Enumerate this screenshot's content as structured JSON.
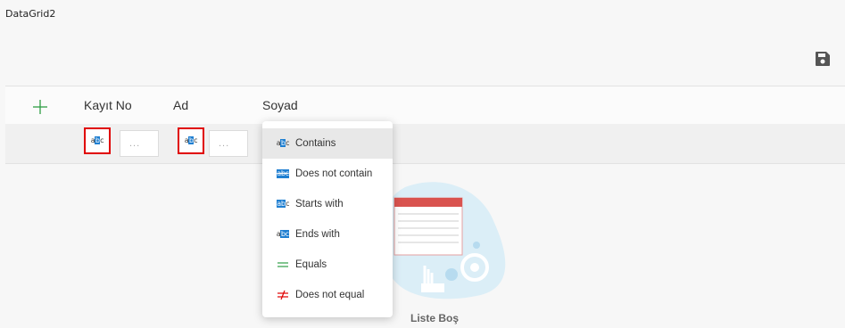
{
  "app": {
    "title": "DataGrid2"
  },
  "toolbar": {
    "save_icon": "floppy-disk-icon"
  },
  "grid": {
    "columns": [
      {
        "label": "Kayıt No"
      },
      {
        "label": "Ad"
      },
      {
        "label": "Soyad"
      }
    ],
    "filter_placeholder": "...",
    "empty_text": "Liste Boş"
  },
  "filter_menu": {
    "items": [
      {
        "label": "Contains",
        "icon": "contains-icon",
        "selected": true
      },
      {
        "label": "Does not contain",
        "icon": "does-not-contain-icon"
      },
      {
        "label": "Starts with",
        "icon": "starts-with-icon"
      },
      {
        "label": "Ends with",
        "icon": "ends-with-icon"
      },
      {
        "label": "Equals",
        "icon": "equals-icon"
      },
      {
        "label": "Does not equal",
        "icon": "not-equal-icon"
      }
    ]
  },
  "colors": {
    "accent_blue": "#1f7fd1",
    "add_green": "#2e9e45",
    "highlight_red": "#e00000"
  }
}
